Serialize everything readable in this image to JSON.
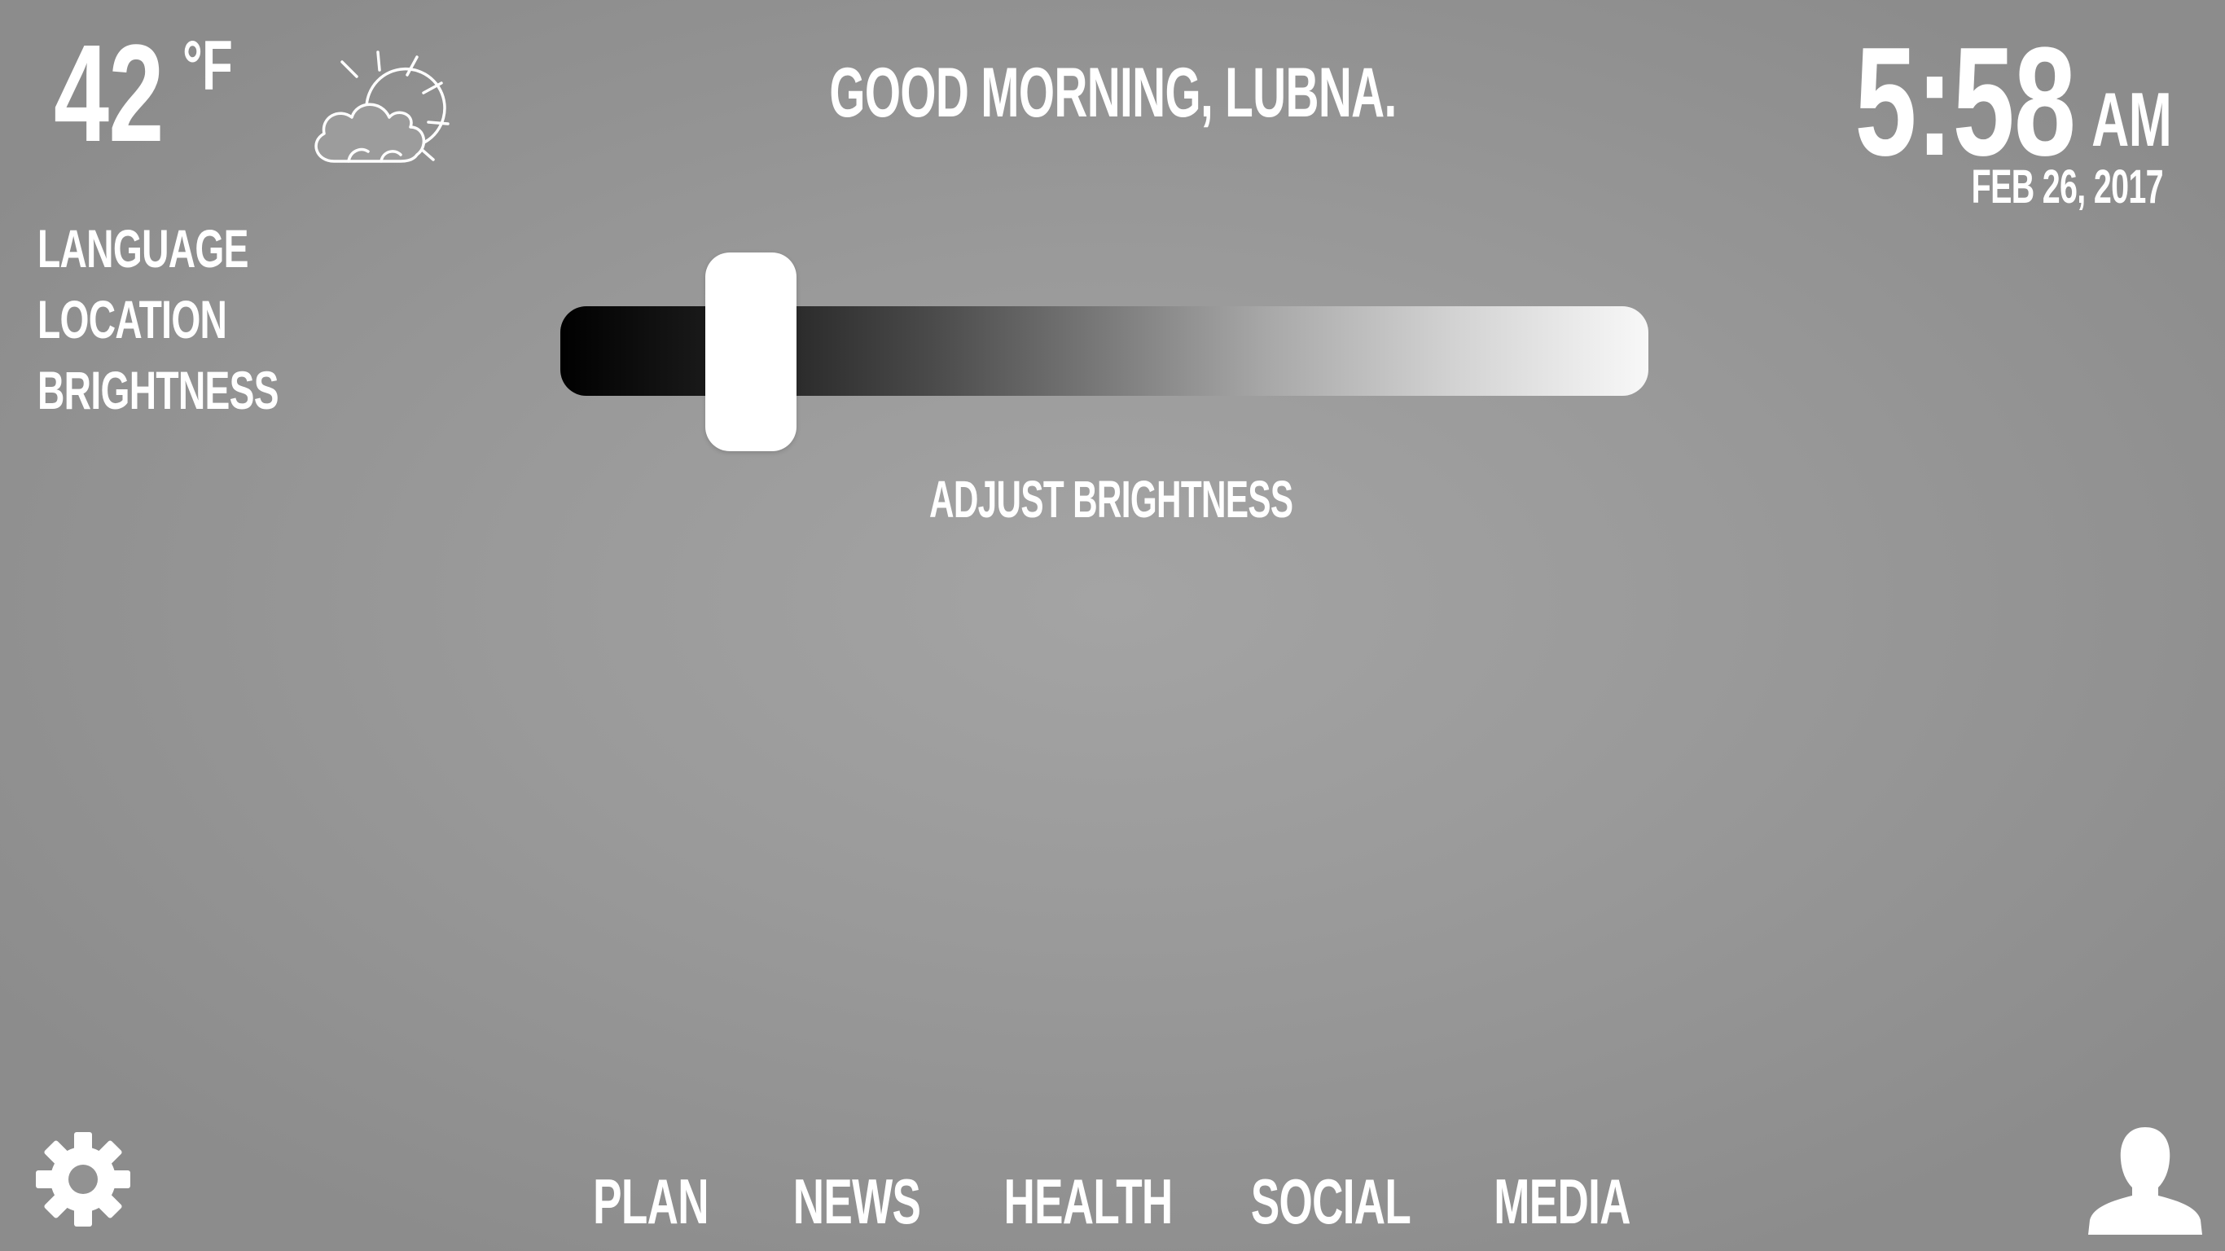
{
  "weather": {
    "temperature": "42",
    "unit": "°F",
    "icon": "partly-cloudy-sun-icon"
  },
  "greeting": "GOOD MORNING, LUBNA.",
  "clock": {
    "time": "5:58",
    "ampm": "AM",
    "date": "FEB 26, 2017"
  },
  "settings_menu": {
    "items": [
      {
        "label": "LANGUAGE"
      },
      {
        "label": "LOCATION"
      },
      {
        "label": "BRIGHTNESS"
      }
    ]
  },
  "brightness": {
    "label": "ADJUST BRIGHTNESS",
    "level": 0.175,
    "track_colors": [
      "#000000",
      "#ffffff"
    ]
  },
  "bottom_nav": {
    "items": [
      {
        "label": "PLAN"
      },
      {
        "label": "NEWS"
      },
      {
        "label": "HEALTH"
      },
      {
        "label": "SOCIAL"
      },
      {
        "label": "MEDIA"
      }
    ]
  },
  "icons": {
    "settings": "gear-icon",
    "profile": "user-silhouette-icon"
  },
  "colors": {
    "text": "#ffffff",
    "background": "#9a9a9a"
  }
}
